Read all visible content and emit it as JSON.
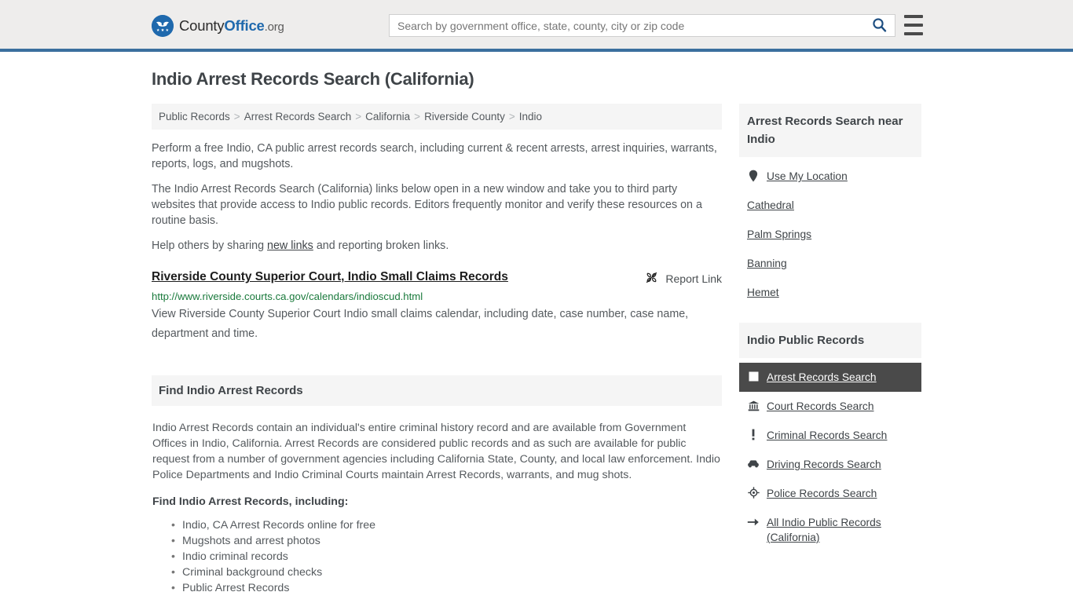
{
  "header": {
    "brand": {
      "part1": "County",
      "part2": "Office",
      "part3": ".org",
      "logo_icon": "eagle-stars-logo"
    },
    "search": {
      "placeholder": "Search by government office, state, county, city or zip code",
      "value": "",
      "search_icon": "search-icon"
    },
    "menu_icon": "hamburger-menu-icon",
    "accent_color": "#3b6f9e"
  },
  "page": {
    "title": "Indio Arrest Records Search (California)"
  },
  "breadcrumb": {
    "separator": ">",
    "items": [
      {
        "label": "Public Records"
      },
      {
        "label": "Arrest Records Search"
      },
      {
        "label": "California"
      },
      {
        "label": "Riverside County"
      },
      {
        "label": "Indio"
      }
    ]
  },
  "intro": {
    "p1": "Perform a free Indio, CA public arrest records search, including current & recent arrests, arrest inquiries, warrants, reports, logs, and mugshots.",
    "p2": "The Indio Arrest Records Search (California) links below open in a new window and take you to third party websites that provide access to Indio public records. Editors frequently monitor and verify these resources on a routine basis.",
    "p3_before": "Help others by sharing ",
    "p3_link": "new links",
    "p3_after": " and reporting broken links."
  },
  "result": {
    "title": "Riverside County Superior Court, Indio Small Claims Records",
    "url": "http://www.riverside.courts.ca.gov/calendars/indioscud.html",
    "description": "View Riverside County Superior Court Indio small claims calendar, including date, case number, case name, department and time.",
    "report_label": "Report Link",
    "report_icon": "broken-link-icon",
    "url_color": "#1a7a3c"
  },
  "find_panel": {
    "heading": "Find Indio Arrest Records",
    "body": "Indio Arrest Records contain an individual's entire criminal history record and are available from Government Offices in Indio, California. Arrest Records are considered public records and as such are available for public request from a number of government agencies including California State, County, and local law enforcement. Indio Police Departments and Indio Criminal Courts maintain Arrest Records, warrants, and mug shots.",
    "subheading": "Find Indio Arrest Records, including:",
    "bullets": [
      "Indio, CA Arrest Records online for free",
      "Mugshots and arrest photos",
      "Indio criminal records",
      "Criminal background checks",
      "Public Arrest Records"
    ]
  },
  "sidebar": {
    "near_box": {
      "heading": "Arrest Records Search near Indio",
      "items": [
        {
          "label": "Use My Location",
          "icon": "map-pin-icon"
        },
        {
          "label": "Cathedral",
          "icon": "none"
        },
        {
          "label": "Palm Springs",
          "icon": "none"
        },
        {
          "label": "Banning",
          "icon": "none"
        },
        {
          "label": "Hemet",
          "icon": "none"
        }
      ]
    },
    "records_box": {
      "heading": "Indio Public Records",
      "active_color": "#4a4a4a",
      "items": [
        {
          "label": "Arrest Records Search",
          "icon": "fingerprint-card-icon",
          "active": true
        },
        {
          "label": "Court Records Search",
          "icon": "courthouse-icon",
          "active": false
        },
        {
          "label": "Criminal Records Search",
          "icon": "exclamation-icon",
          "active": false
        },
        {
          "label": "Driving Records Search",
          "icon": "car-icon",
          "active": false
        },
        {
          "label": "Police Records Search",
          "icon": "police-badge-icon",
          "active": false
        },
        {
          "label": "All Indio Public Records (California)",
          "icon": "arrow-right-icon",
          "active": false
        }
      ]
    }
  }
}
